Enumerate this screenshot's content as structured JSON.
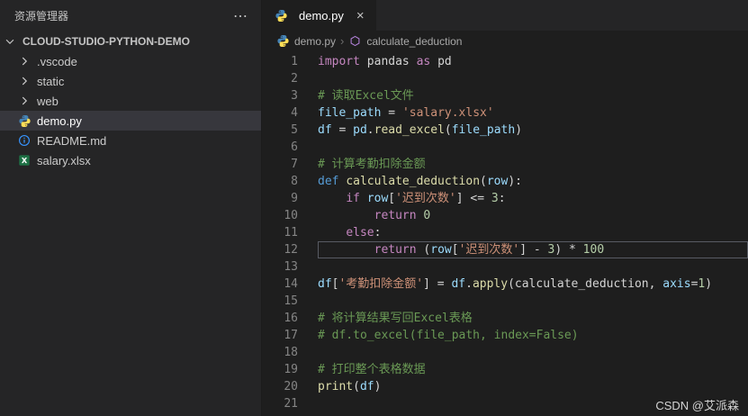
{
  "sidebar": {
    "title": "资源管理器",
    "more_icon": "⋯",
    "root_label": "CLOUD-STUDIO-PYTHON-DEMO",
    "items": [
      {
        "label": ".vscode",
        "icon": "chevron-right-icon",
        "selected": false
      },
      {
        "label": "static",
        "icon": "chevron-right-icon",
        "selected": false
      },
      {
        "label": "web",
        "icon": "chevron-right-icon",
        "selected": false
      },
      {
        "label": "demo.py",
        "icon": "python-icon",
        "selected": true
      },
      {
        "label": "README.md",
        "icon": "info-icon",
        "selected": false
      },
      {
        "label": "salary.xlsx",
        "icon": "excel-icon",
        "selected": false
      }
    ]
  },
  "editor": {
    "tab": {
      "label": "demo.py",
      "close_icon": "×"
    },
    "breadcrumb": {
      "file": "demo.py",
      "separator": "›",
      "symbol": "calculate_deduction"
    },
    "current_line": 12,
    "token_colors": {
      "k": "#c586c0",
      "d": "#569cd6",
      "f": "#dcdcaa",
      "v": "#9cdcfe",
      "s": "#ce9178",
      "c": "#6a9955",
      "n": "#b5cea8",
      "p": "#d4d4d4"
    },
    "lines": [
      {
        "num": 1,
        "tokens": [
          {
            "t": "k",
            "s": "import"
          },
          {
            "t": "p",
            "s": " pandas "
          },
          {
            "t": "k",
            "s": "as"
          },
          {
            "t": "p",
            "s": " pd"
          }
        ]
      },
      {
        "num": 2,
        "tokens": []
      },
      {
        "num": 3,
        "tokens": [
          {
            "t": "c",
            "s": "# 读取Excel文件"
          }
        ]
      },
      {
        "num": 4,
        "tokens": [
          {
            "t": "v",
            "s": "file_path"
          },
          {
            "t": "p",
            "s": " = "
          },
          {
            "t": "s",
            "s": "'salary.xlsx'"
          }
        ]
      },
      {
        "num": 5,
        "tokens": [
          {
            "t": "v",
            "s": "df"
          },
          {
            "t": "p",
            "s": " = "
          },
          {
            "t": "v",
            "s": "pd"
          },
          {
            "t": "p",
            "s": "."
          },
          {
            "t": "f",
            "s": "read_excel"
          },
          {
            "t": "p",
            "s": "("
          },
          {
            "t": "v",
            "s": "file_path"
          },
          {
            "t": "p",
            "s": ")"
          }
        ]
      },
      {
        "num": 6,
        "tokens": []
      },
      {
        "num": 7,
        "tokens": [
          {
            "t": "c",
            "s": "# 计算考勤扣除金额"
          }
        ]
      },
      {
        "num": 8,
        "tokens": [
          {
            "t": "d",
            "s": "def"
          },
          {
            "t": "p",
            "s": " "
          },
          {
            "t": "f",
            "s": "calculate_deduction"
          },
          {
            "t": "p",
            "s": "("
          },
          {
            "t": "v",
            "s": "row"
          },
          {
            "t": "p",
            "s": "):"
          }
        ]
      },
      {
        "num": 9,
        "tokens": [
          {
            "t": "p",
            "s": "    "
          },
          {
            "t": "k",
            "s": "if"
          },
          {
            "t": "p",
            "s": " "
          },
          {
            "t": "v",
            "s": "row"
          },
          {
            "t": "p",
            "s": "["
          },
          {
            "t": "s",
            "s": "'迟到次数'"
          },
          {
            "t": "p",
            "s": "] <= "
          },
          {
            "t": "n",
            "s": "3"
          },
          {
            "t": "p",
            "s": ":"
          }
        ]
      },
      {
        "num": 10,
        "tokens": [
          {
            "t": "p",
            "s": "        "
          },
          {
            "t": "k",
            "s": "return"
          },
          {
            "t": "p",
            "s": " "
          },
          {
            "t": "n",
            "s": "0"
          }
        ]
      },
      {
        "num": 11,
        "tokens": [
          {
            "t": "p",
            "s": "    "
          },
          {
            "t": "k",
            "s": "else"
          },
          {
            "t": "p",
            "s": ":"
          }
        ]
      },
      {
        "num": 12,
        "tokens": [
          {
            "t": "p",
            "s": "        "
          },
          {
            "t": "k",
            "s": "return"
          },
          {
            "t": "p",
            "s": " ("
          },
          {
            "t": "v",
            "s": "row"
          },
          {
            "t": "p",
            "s": "["
          },
          {
            "t": "s",
            "s": "'迟到次数'"
          },
          {
            "t": "p",
            "s": "] - "
          },
          {
            "t": "n",
            "s": "3"
          },
          {
            "t": "p",
            "s": ") * "
          },
          {
            "t": "n",
            "s": "100"
          }
        ]
      },
      {
        "num": 13,
        "tokens": []
      },
      {
        "num": 14,
        "tokens": [
          {
            "t": "v",
            "s": "df"
          },
          {
            "t": "p",
            "s": "["
          },
          {
            "t": "s",
            "s": "'考勤扣除金额'"
          },
          {
            "t": "p",
            "s": "] = "
          },
          {
            "t": "v",
            "s": "df"
          },
          {
            "t": "p",
            "s": "."
          },
          {
            "t": "f",
            "s": "apply"
          },
          {
            "t": "p",
            "s": "("
          },
          {
            "t": "p",
            "s": "calculate_deduction"
          },
          {
            "t": "p",
            "s": ", "
          },
          {
            "t": "v",
            "s": "axis"
          },
          {
            "t": "p",
            "s": "="
          },
          {
            "t": "n",
            "s": "1"
          },
          {
            "t": "p",
            "s": ")"
          }
        ]
      },
      {
        "num": 15,
        "tokens": []
      },
      {
        "num": 16,
        "tokens": [
          {
            "t": "c",
            "s": "# 将计算结果写回Excel表格"
          }
        ]
      },
      {
        "num": 17,
        "tokens": [
          {
            "t": "c",
            "s": "# df.to_excel(file_path, index=False)"
          }
        ]
      },
      {
        "num": 18,
        "tokens": []
      },
      {
        "num": 19,
        "tokens": [
          {
            "t": "c",
            "s": "# 打印整个表格数据"
          }
        ]
      },
      {
        "num": 20,
        "tokens": [
          {
            "t": "f",
            "s": "print"
          },
          {
            "t": "p",
            "s": "("
          },
          {
            "t": "v",
            "s": "df"
          },
          {
            "t": "p",
            "s": ")"
          }
        ]
      },
      {
        "num": 21,
        "tokens": []
      }
    ]
  },
  "watermark": "CSDN @艾派森",
  "colors": {
    "editor_bg": "#1e1e1e",
    "sidebar_bg": "#252526",
    "selected_row_bg": "#37373d",
    "line_number": "#858585"
  }
}
